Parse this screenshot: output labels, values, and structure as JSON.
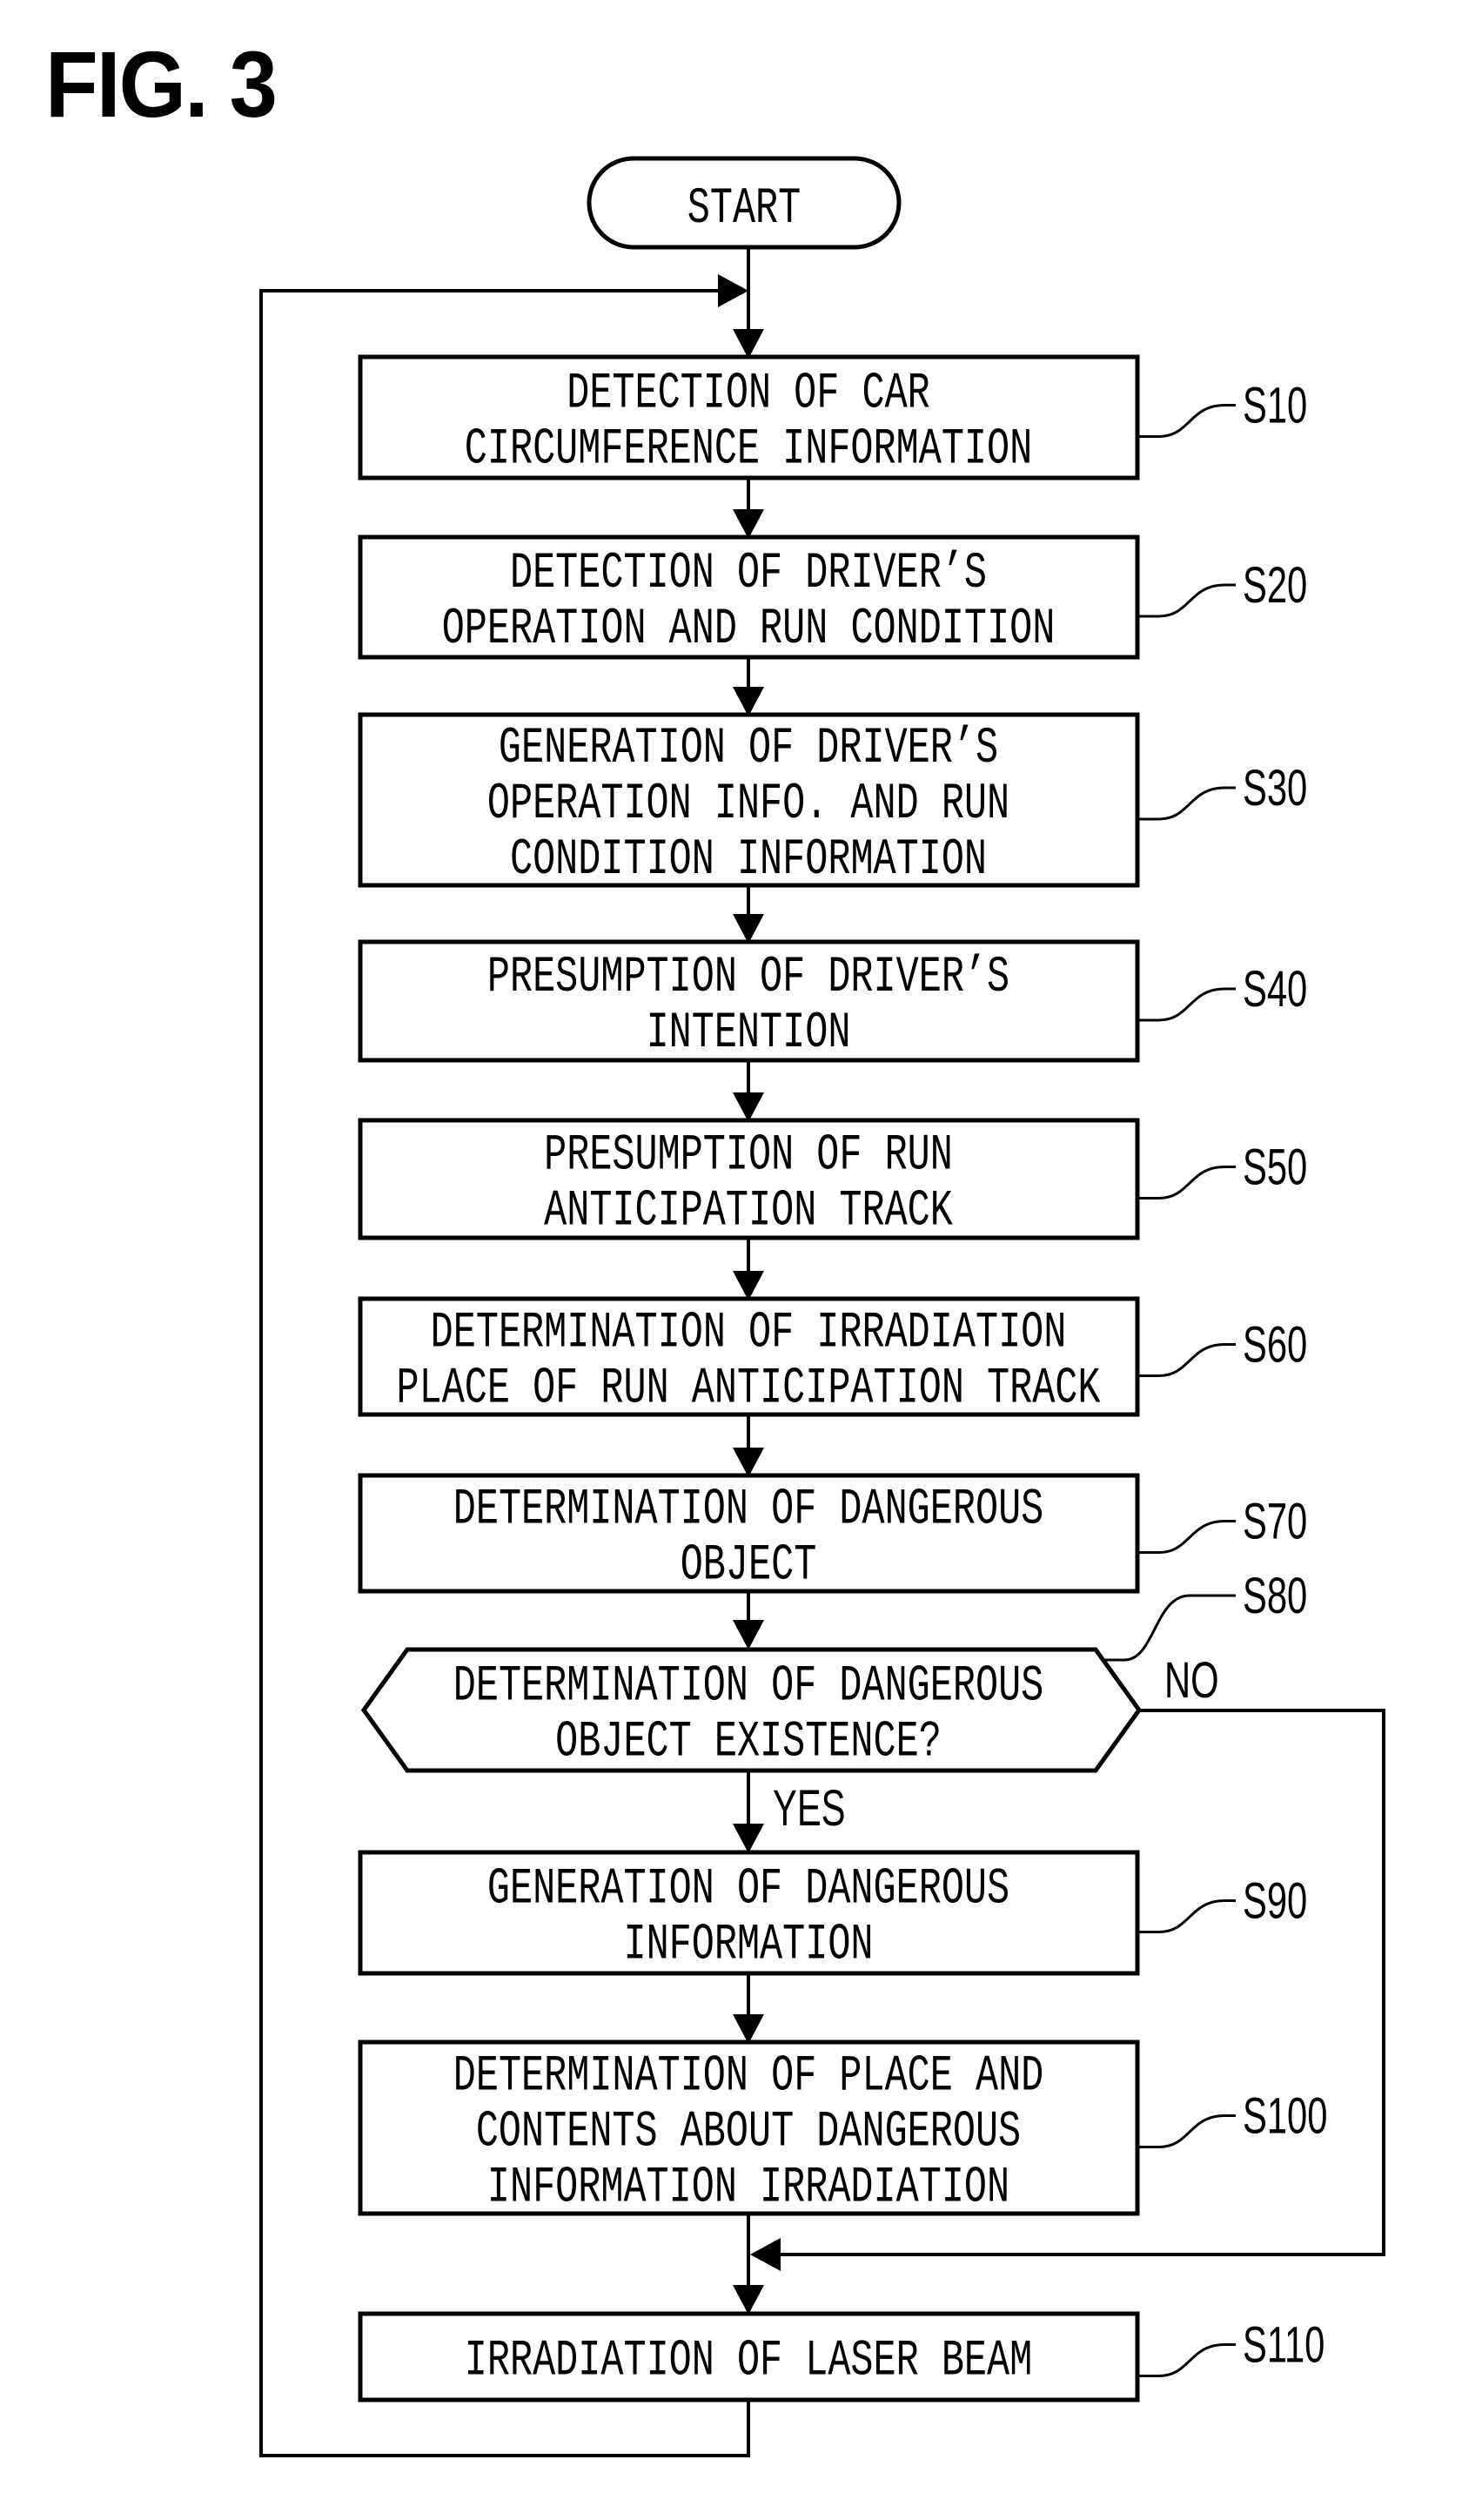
{
  "figure": {
    "title": "FIG. 3"
  },
  "start": {
    "label": "START"
  },
  "steps": [
    {
      "id": "S10",
      "lines": [
        "DETECTION OF CAR",
        "CIRCUMFERENCE INFORMATION"
      ]
    },
    {
      "id": "S20",
      "lines": [
        "DETECTION OF DRIVER’S",
        "OPERATION AND RUN CONDITION"
      ]
    },
    {
      "id": "S30",
      "lines": [
        "GENERATION OF DRIVER’S",
        "OPERATION INFO. AND RUN",
        "CONDITION INFORMATION"
      ]
    },
    {
      "id": "S40",
      "lines": [
        "PRESUMPTION OF DRIVER’S",
        "INTENTION"
      ]
    },
    {
      "id": "S50",
      "lines": [
        "PRESUMPTION OF RUN",
        "ANTICIPATION TRACK"
      ]
    },
    {
      "id": "S60",
      "lines": [
        "DETERMINATION OF IRRADIATION",
        "PLACE OF RUN ANTICIPATION TRACK"
      ]
    },
    {
      "id": "S70",
      "lines": [
        "DETERMINATION OF DANGEROUS",
        "OBJECT"
      ]
    },
    {
      "id": "S80",
      "type": "decision",
      "lines": [
        "DETERMINATION OF DANGEROUS",
        "OBJECT EXISTENCE?"
      ],
      "yes_label": "YES",
      "no_label": "NO"
    },
    {
      "id": "S90",
      "lines": [
        "GENERATION OF DANGEROUS",
        "INFORMATION"
      ]
    },
    {
      "id": "S100",
      "lines": [
        "DETERMINATION OF PLACE AND",
        "CONTENTS ABOUT DANGEROUS",
        "INFORMATION IRRADIATION"
      ]
    },
    {
      "id": "S110",
      "lines": [
        "IRRADIATION OF LASER BEAM"
      ]
    }
  ],
  "edges": [
    {
      "from": "START",
      "to": "S10"
    },
    {
      "from": "S10",
      "to": "S20"
    },
    {
      "from": "S20",
      "to": "S30"
    },
    {
      "from": "S30",
      "to": "S40"
    },
    {
      "from": "S40",
      "to": "S50"
    },
    {
      "from": "S50",
      "to": "S60"
    },
    {
      "from": "S60",
      "to": "S70"
    },
    {
      "from": "S70",
      "to": "S80"
    },
    {
      "from": "S80",
      "to": "S90",
      "label": "YES"
    },
    {
      "from": "S80",
      "to": "S110",
      "label": "NO"
    },
    {
      "from": "S90",
      "to": "S100"
    },
    {
      "from": "S100",
      "to": "S110"
    },
    {
      "from": "S110",
      "to": "S10",
      "label": "loop"
    }
  ]
}
